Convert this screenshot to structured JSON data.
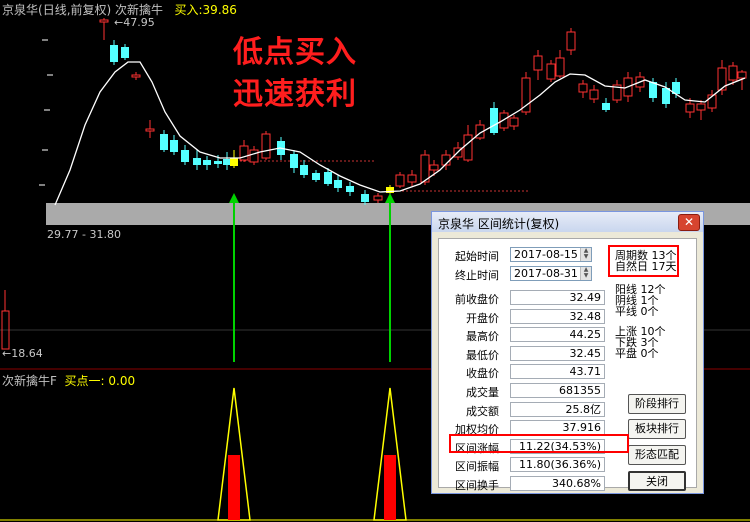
{
  "header": {
    "name": "京泉华",
    "period": "(日线,前复权)",
    "indicator": "次新擒牛",
    "buy_label": "买入:",
    "buy_value": "39.86"
  },
  "chart": {
    "price_high_label": "47.95",
    "price_low_label": "18.64",
    "band_label": "29.77 - 31.80",
    "banner_line1": "低点买入",
    "banner_line2": "迅速获利",
    "up_color": "#ff3232",
    "down_color": "#54ffff",
    "ma_color": "#ffffff"
  },
  "sub_panel": {
    "name": "次新擒牛F",
    "buy_point_label": "买点一:",
    "buy_point_value": "0.00",
    "signal_color": "#ff0000",
    "outline_color": "#ffff00"
  },
  "dialog": {
    "title": "京泉华 区间统计(复权)",
    "close_glyph": "✕",
    "start_label": "起始时间",
    "start_value": "2017-08-15",
    "end_label": "终止时间",
    "end_value": "2017-08-31",
    "rows": [
      {
        "label": "前收盘价",
        "value": "32.49"
      },
      {
        "label": "开盘价",
        "value": "32.48"
      },
      {
        "label": "最高价",
        "value": "44.25"
      },
      {
        "label": "最低价",
        "value": "32.45"
      },
      {
        "label": "收盘价",
        "value": "43.71"
      },
      {
        "label": "成交量",
        "value": "681355"
      },
      {
        "label": "成交额",
        "value": "25.8亿"
      },
      {
        "label": "加权均价",
        "value": "37.916"
      },
      {
        "label": "区间涨幅",
        "value": "11.22(34.53%)"
      },
      {
        "label": "区间振幅",
        "value": "11.80(36.36%)"
      },
      {
        "label": "区间换手",
        "value": "340.68%"
      }
    ],
    "period_count": "周期数 13个",
    "natural_days": "自然日 17天",
    "yang_lines": "阳线 12个",
    "yin_lines": "阴线 1个",
    "flat_lines": "平线 0个",
    "up_count": "上涨 10个",
    "down_count": "下跌 3个",
    "flat_count": "平盘 0个",
    "buttons": {
      "stage_rank": "阶段排行",
      "sector_rank": "板块排行",
      "pattern_match": "形态匹配",
      "close": "关闭"
    }
  }
}
